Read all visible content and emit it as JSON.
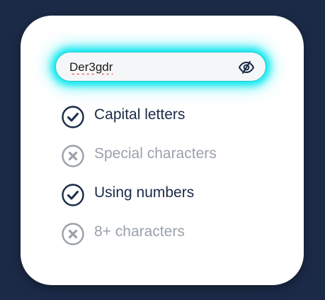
{
  "password_field": {
    "value": "Der3gdr",
    "visibility_icon": "eye-slash-icon"
  },
  "requirements": [
    {
      "label": "Capital letters",
      "met": true,
      "icon": "check-circle-icon"
    },
    {
      "label": "Special characters",
      "met": false,
      "icon": "x-circle-icon"
    },
    {
      "label": "Using numbers",
      "met": true,
      "icon": "check-circle-icon"
    },
    {
      "label": "8+ characters",
      "met": false,
      "icon": "x-circle-icon"
    }
  ],
  "colors": {
    "background": "#1b2a47",
    "card": "#ffffff",
    "glow": "#00e8f0",
    "met": "#1b2a47",
    "unmet": "#9aa1ab"
  }
}
